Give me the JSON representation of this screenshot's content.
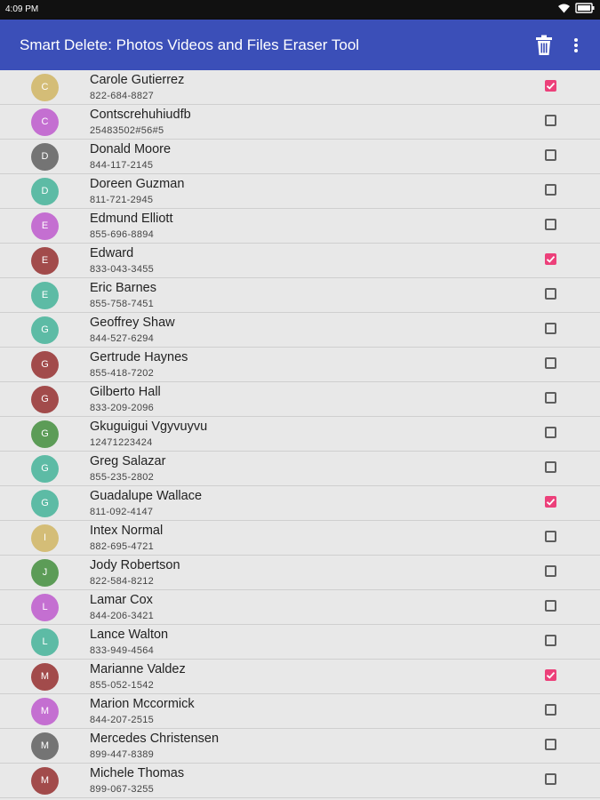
{
  "status_bar": {
    "time": "4:09 PM"
  },
  "app_bar": {
    "title": "Smart Delete: Photos Videos and Files Eraser Tool"
  },
  "colors": {
    "app_bar": "#3b4fb8",
    "checkbox_checked": "#ec407a"
  },
  "contacts": [
    {
      "initial": "C",
      "name": "Carole Gutierrez",
      "phone": "822-684-8827",
      "color": "#d4bd77",
      "checked": true
    },
    {
      "initial": "C",
      "name": "Contscrehuhiudfb",
      "phone": "25483502#56#5",
      "color": "#c46fd1",
      "checked": false
    },
    {
      "initial": "D",
      "name": "Donald Moore",
      "phone": "844-117-2145",
      "color": "#747474",
      "checked": false
    },
    {
      "initial": "D",
      "name": "Doreen Guzman",
      "phone": "811-721-2945",
      "color": "#5dbba5",
      "checked": false
    },
    {
      "initial": "E",
      "name": "Edmund Elliott",
      "phone": "855-696-8894",
      "color": "#c46fd1",
      "checked": false
    },
    {
      "initial": "E",
      "name": "Edward",
      "phone": "833-043-3455",
      "color": "#a24b4b",
      "checked": true
    },
    {
      "initial": "E",
      "name": "Eric Barnes",
      "phone": "855-758-7451",
      "color": "#5dbba5",
      "checked": false
    },
    {
      "initial": "G",
      "name": "Geoffrey Shaw",
      "phone": "844-527-6294",
      "color": "#5dbba5",
      "checked": false
    },
    {
      "initial": "G",
      "name": "Gertrude Haynes",
      "phone": "855-418-7202",
      "color": "#a24b4b",
      "checked": false
    },
    {
      "initial": "G",
      "name": "Gilberto Hall",
      "phone": "833-209-2096",
      "color": "#a24b4b",
      "checked": false
    },
    {
      "initial": "G",
      "name": "Gkuguigui Vgyvuyvu",
      "phone": "12471223424",
      "color": "#5c9c57",
      "checked": false
    },
    {
      "initial": "G",
      "name": "Greg Salazar",
      "phone": "855-235-2802",
      "color": "#5dbba5",
      "checked": false
    },
    {
      "initial": "G",
      "name": "Guadalupe Wallace",
      "phone": "811-092-4147",
      "color": "#5dbba5",
      "checked": true
    },
    {
      "initial": "I",
      "name": "Intex Normal",
      "phone": "882-695-4721",
      "color": "#d4bd77",
      "checked": false
    },
    {
      "initial": "J",
      "name": "Jody Robertson",
      "phone": "822-584-8212",
      "color": "#5c9c57",
      "checked": false
    },
    {
      "initial": "L",
      "name": "Lamar Cox",
      "phone": "844-206-3421",
      "color": "#c46fd1",
      "checked": false
    },
    {
      "initial": "L",
      "name": "Lance Walton",
      "phone": "833-949-4564",
      "color": "#5dbba5",
      "checked": false
    },
    {
      "initial": "M",
      "name": "Marianne Valdez",
      "phone": "855-052-1542",
      "color": "#a24b4b",
      "checked": true
    },
    {
      "initial": "M",
      "name": "Marion Mccormick",
      "phone": "844-207-2515",
      "color": "#c46fd1",
      "checked": false
    },
    {
      "initial": "M",
      "name": "Mercedes Christensen",
      "phone": "899-447-8389",
      "color": "#747474",
      "checked": false
    },
    {
      "initial": "M",
      "name": "Michele Thomas",
      "phone": "899-067-3255",
      "color": "#a24b4b",
      "checked": false
    }
  ]
}
